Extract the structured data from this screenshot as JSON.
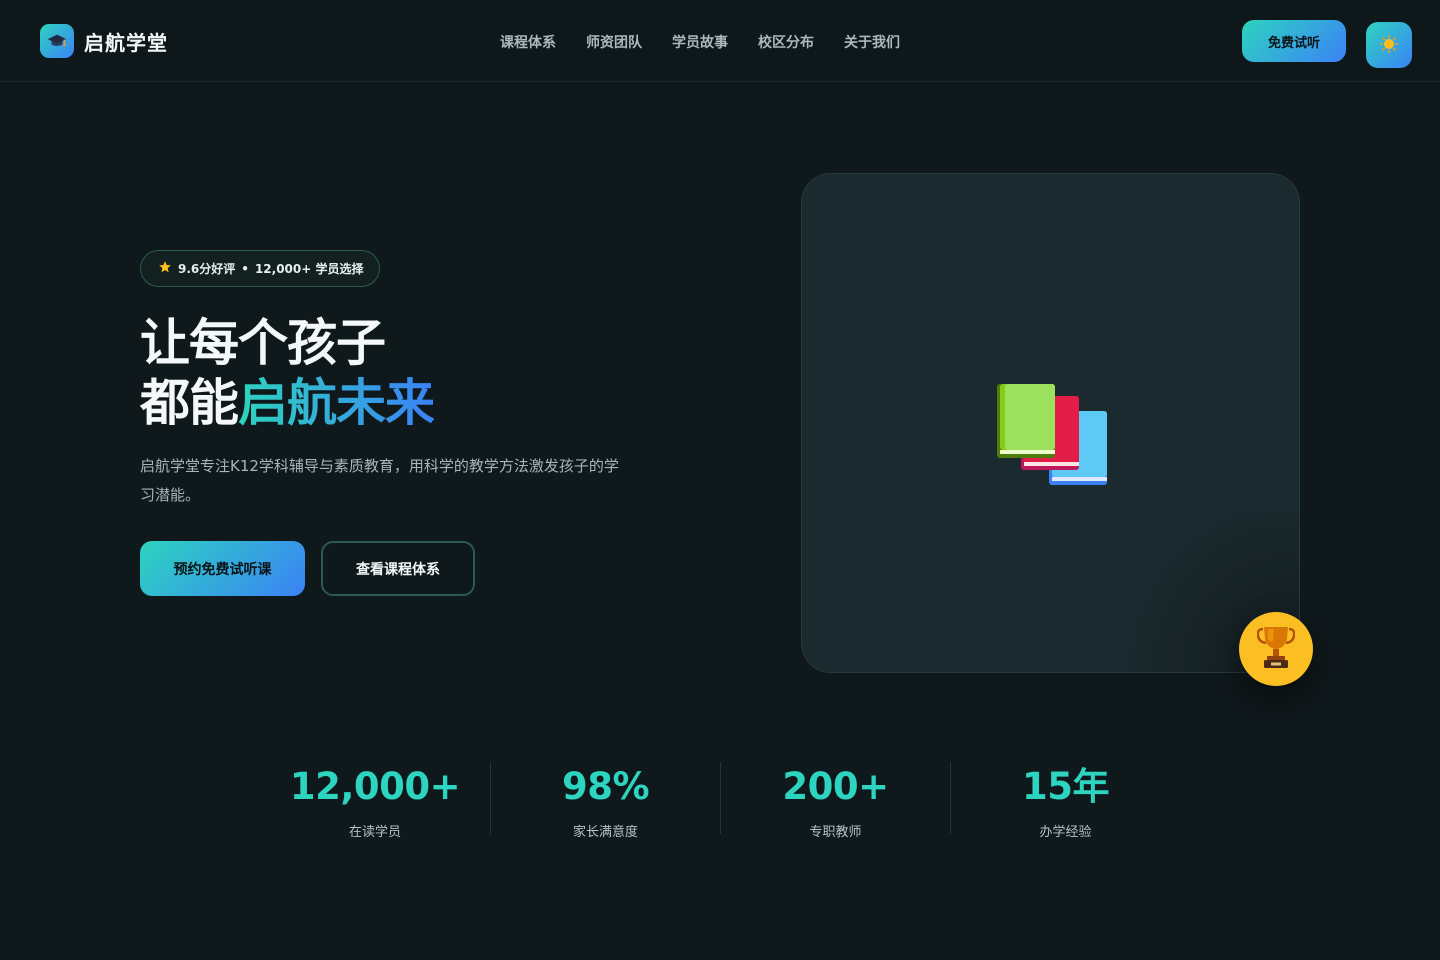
{
  "brand": {
    "name": "启航学堂",
    "logo_icon": "graduation-cap-icon"
  },
  "nav": {
    "items": [
      "课程体系",
      "师资团队",
      "学员故事",
      "校区分布",
      "关于我们"
    ]
  },
  "header": {
    "trial_label": "免费试听",
    "theme_icon": "sun-icon"
  },
  "hero": {
    "badge": {
      "icon": "star-icon",
      "rating": "9.6分好评",
      "separator": "•",
      "students": "12,000+ 学员选择"
    },
    "headline_line1": "让每个孩子",
    "headline_line2_plain": "都能",
    "headline_line2_highlight": "启航未来",
    "description": "启航学堂专注K12学科辅导与素质教育，用科学的教学方法激发孩子的学习潜能。",
    "primary_cta": "预约免费试听课",
    "secondary_cta": "查看课程体系",
    "card_icon": "books-icon",
    "floating_icon": "trophy-icon"
  },
  "stats": [
    {
      "value": "12,000+",
      "label": "在读学员"
    },
    {
      "value": "98%",
      "label": "家长满意度"
    },
    {
      "value": "200+",
      "label": "专职教师"
    },
    {
      "value": "15年",
      "label": "办学经验"
    }
  ],
  "colors": {
    "background": "#0f181b",
    "accent_start": "#2dd4bf",
    "accent_end": "#3b82f6",
    "card": "#1b2a2f",
    "trophy_bg": "#fbbf24"
  }
}
